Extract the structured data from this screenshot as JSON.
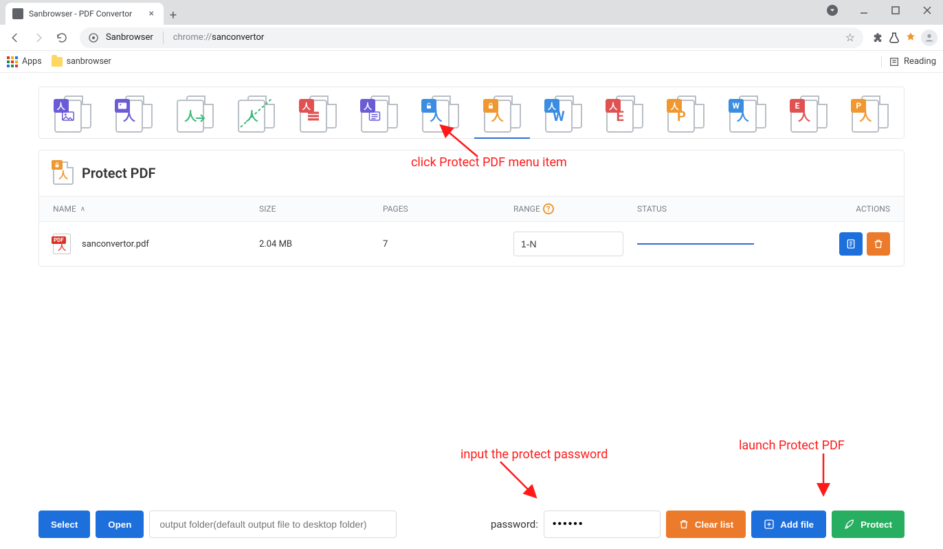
{
  "window": {
    "tab_title": "Sanbrowser - PDF Convertor"
  },
  "toolbar": {
    "address_main": "Sanbrowser",
    "address_proto": "chrome://",
    "address_path": "sanconvertor"
  },
  "bookmarks": {
    "apps_label": "Apps",
    "item1": "sanbrowser",
    "reading": "Reading"
  },
  "tools": [
    "pdf-to-image",
    "image-to-pdf",
    "split-pdf",
    "rotate-pdf",
    "merge-pdf",
    "extract-text",
    "unlock-pdf",
    "protect-pdf",
    "pdf-to-word",
    "word-to-pdf",
    "pdf-to-ppt",
    "ppt-to-pdf",
    "pdf-to-excel",
    "excel-to-pdf"
  ],
  "panel": {
    "title": "Protect PDF"
  },
  "columns": {
    "name": "NAME",
    "size": "SIZE",
    "pages": "PAGES",
    "range": "RANGE",
    "status": "STATUS",
    "actions": "ACTIONS"
  },
  "rows": [
    {
      "name": "sanconvertor.pdf",
      "size": "2.04 MB",
      "pages": "7",
      "range": "1-N"
    }
  ],
  "footer": {
    "select": "Select",
    "open": "Open",
    "output_placeholder": "output folder(default output file to desktop folder)",
    "password_label": "password:",
    "password_value": "••••••",
    "clear": "Clear list",
    "add": "Add file",
    "protect": "Protect"
  },
  "anno": {
    "a1": "click Protect PDF menu item",
    "a2": "input the protect password",
    "a3": "launch Protect PDF"
  }
}
